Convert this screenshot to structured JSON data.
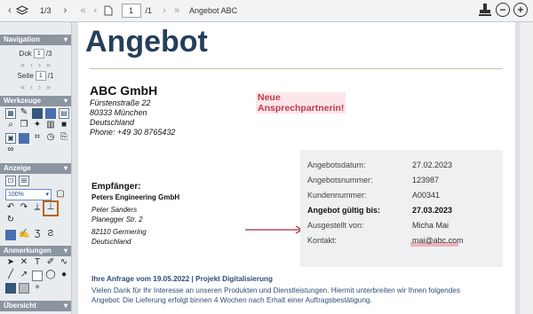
{
  "toolbar": {
    "doc_counter": "1/3",
    "page_value": "1",
    "page_total": "/1",
    "file_name": "Angebot ABC"
  },
  "sidebar": {
    "navigation": {
      "heading": "Navigation",
      "doc_label": "Dok",
      "doc_value": "1",
      "doc_total": "/3",
      "page_label": "Seite",
      "page_value": "1",
      "page_total": "/1"
    },
    "tools": {
      "heading": "Werkzeuge"
    },
    "view": {
      "heading": "Anzeige",
      "zoom": "100%"
    },
    "annotations": {
      "heading": "Anmerkungen"
    },
    "overview": {
      "heading": "Übersicht"
    }
  },
  "document": {
    "title": "Angebot",
    "sender": {
      "name": "ABC GmbH",
      "street": "Fürstenstraße 22",
      "city": "80333 München",
      "country": "Deutschland",
      "phone": "Phone: +49 30 8765432"
    },
    "note_line1": "Neue",
    "note_line2": "Ansprechpartnerin!",
    "recipient": {
      "heading": "Empfänger:",
      "company": "Peters Engineering GmbH",
      "person": "Peter Sanders",
      "street": "Planegger Str. 2",
      "city": "82110 Germering",
      "country": "Deutschland"
    },
    "info": [
      {
        "label": "Angebotsdatum:",
        "value": "27.02.2023",
        "bold": false
      },
      {
        "label": "Angebotsnummer:",
        "value": "123987",
        "bold": false
      },
      {
        "label": "Kundennummer:",
        "value": "A00341",
        "bold": false
      },
      {
        "label": "Angebot gültig bis:",
        "value": "27.03.2023",
        "bold": true
      },
      {
        "label": "Ausgestellt von:",
        "value": "Micha Mai",
        "bold": false
      },
      {
        "label": "Kontakt:",
        "value": "mai@abc.com",
        "bold": false
      }
    ],
    "subject": "Ihre Anfrage vom 19.05.2022 | Projekt Digitalisierung",
    "body_line1": "Vielen Dank für Ihr Interesse an unseren Produkten und Dienstleistungen. Hiermit unterbreiten wir Ihnen folgendes",
    "body_line2": "Angebot: Die Lieferung erfolgt binnen 4 Wochen nach Erhalt einer Auftragsbestätigung."
  },
  "colors": {
    "title": "#253e5c",
    "note": "#c23a4a",
    "sidebar_header": "#8a959f",
    "highlight_box": "#b5651d"
  }
}
